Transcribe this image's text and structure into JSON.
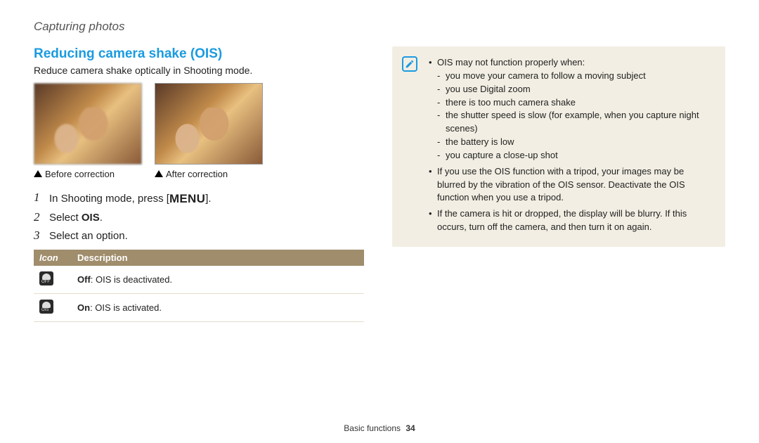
{
  "header": {
    "breadcrumb": "Capturing photos"
  },
  "section": {
    "title": "Reducing camera shake (OIS)",
    "intro": "Reduce camera shake optically in Shooting mode."
  },
  "photos": {
    "before_caption": "Before correction",
    "after_caption": "After correction"
  },
  "steps": [
    {
      "num": "1",
      "pre": "In Shooting mode, press [",
      "key": "MENU",
      "post": "]."
    },
    {
      "num": "2",
      "pre": "Select ",
      "bold": "OIS",
      "post": "."
    },
    {
      "num": "3",
      "pre": "Select an option.",
      "bold": "",
      "post": ""
    }
  ],
  "table": {
    "head_icon": "Icon",
    "head_desc": "Description",
    "rows": [
      {
        "label": "Off",
        "desc": ": OIS is deactivated."
      },
      {
        "label": "On",
        "desc": ": OIS is activated."
      }
    ]
  },
  "notes": {
    "lead": "OIS may not function properly when:",
    "reasons": [
      "you move your camera to follow a moving subject",
      "you use Digital zoom",
      "there is too much camera shake",
      "the shutter speed is slow (for example, when you capture night scenes)",
      "the battery is low",
      "you capture a close-up shot"
    ],
    "extra": [
      "If you use the OIS function with a tripod, your images may be blurred by the vibration of the OIS sensor. Deactivate the OIS function when you use a tripod.",
      "If the camera is hit or dropped, the display will be blurry. If this occurs, turn off the camera, and then turn it on again."
    ]
  },
  "footer": {
    "section": "Basic functions",
    "page": "34"
  }
}
